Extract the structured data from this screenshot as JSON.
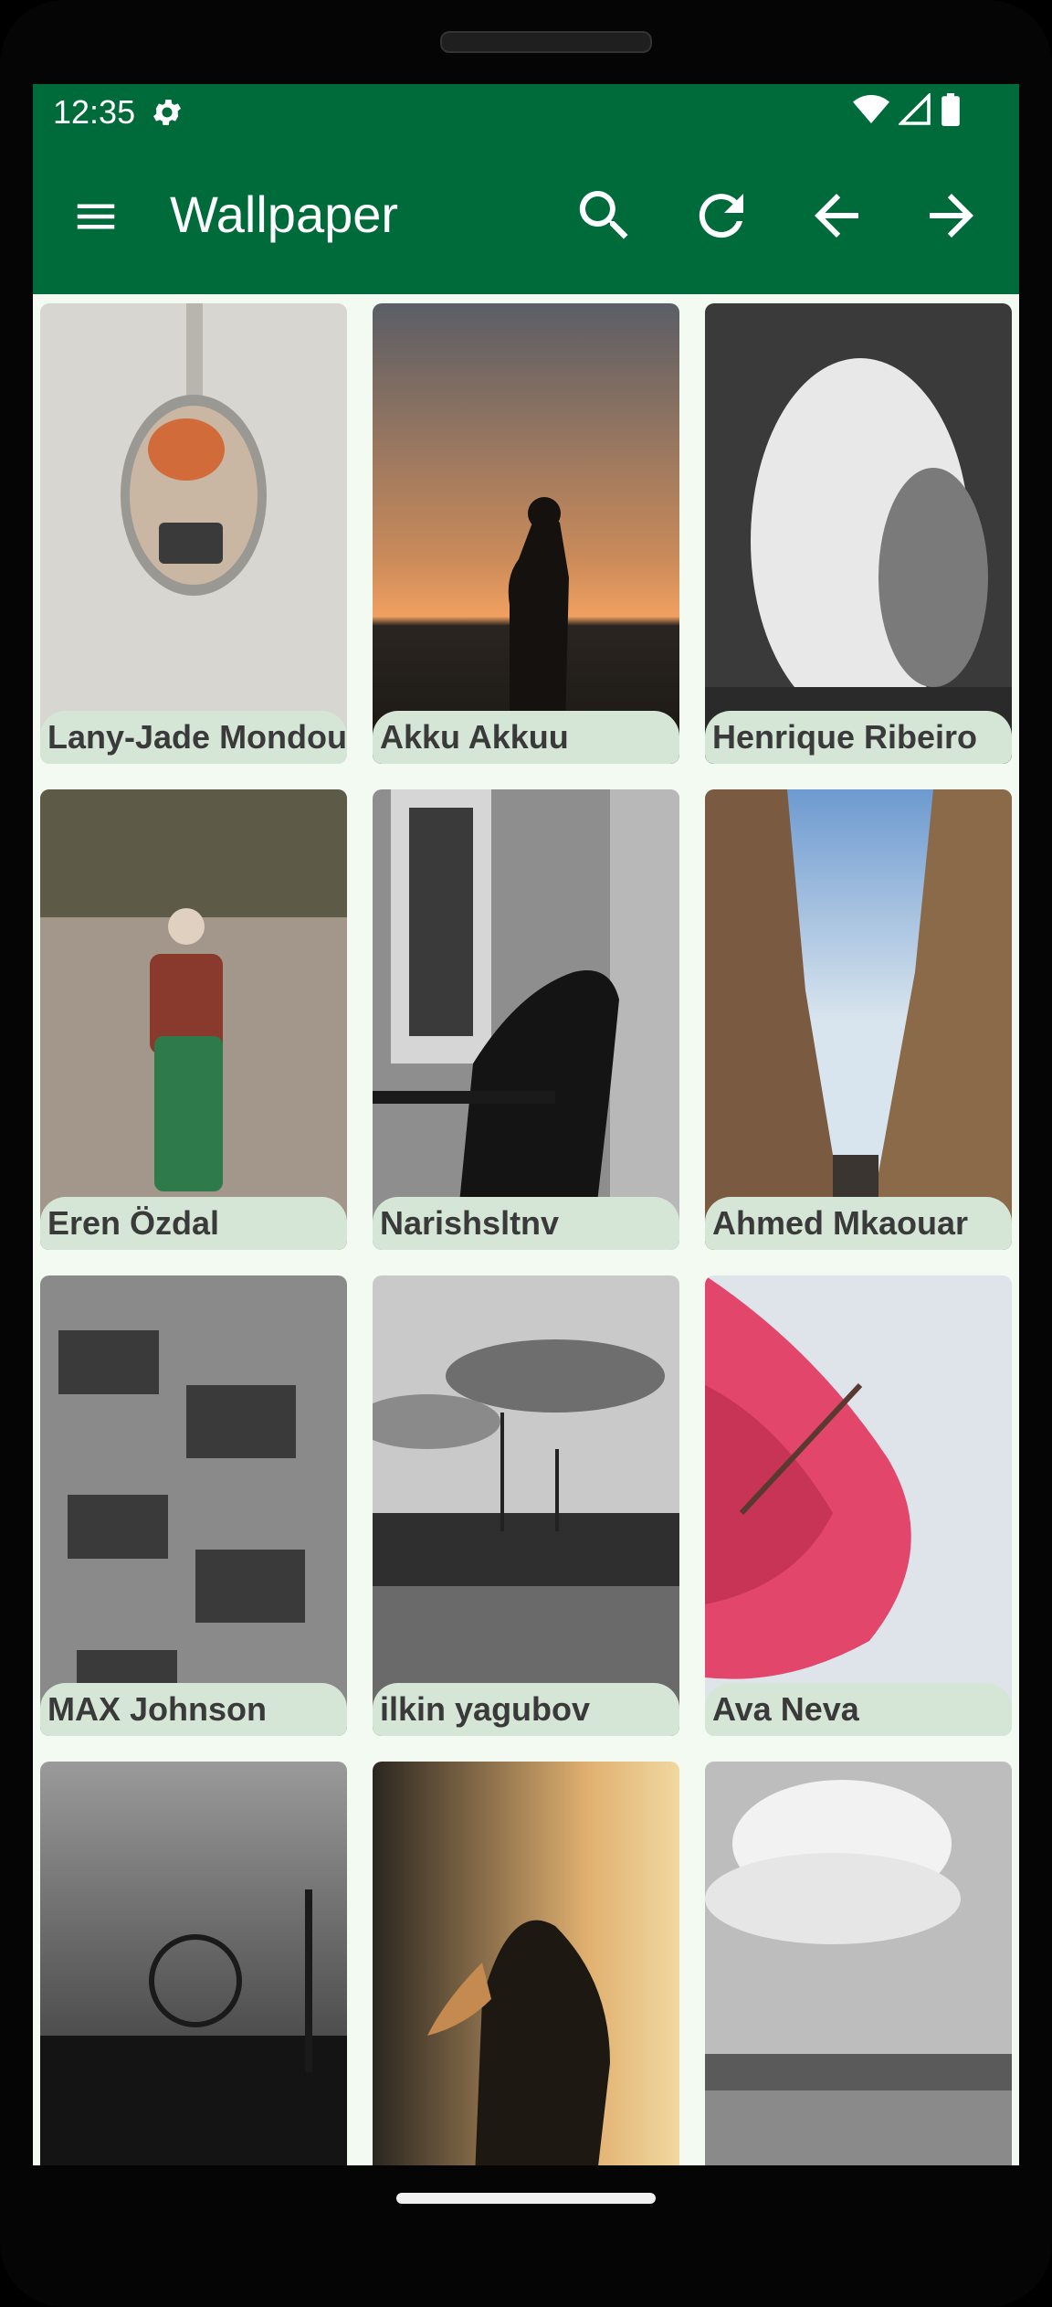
{
  "status": {
    "time": "12:35",
    "icons": [
      "settings-gear-icon",
      "wifi-icon",
      "cellular-signal-icon",
      "battery-icon"
    ]
  },
  "app_bar": {
    "title": "Wallpaper",
    "actions": [
      "search-icon",
      "refresh-icon",
      "arrow-back-icon",
      "arrow-forward-icon"
    ]
  },
  "colors": {
    "primary": "#006b3a",
    "background": "#f3faf1",
    "label_chip": "#d5e6d7"
  },
  "cards": [
    {
      "name": "Lany-Jade Mondou"
    },
    {
      "name": "Akku Akkuu"
    },
    {
      "name": "Henrique Ribeiro"
    },
    {
      "name": "Eren Özdal"
    },
    {
      "name": "Narishsltnv"
    },
    {
      "name": "Ahmed Mkaouar"
    },
    {
      "name": "MAX Johnson"
    },
    {
      "name": "ilkin yagubov"
    },
    {
      "name": "Ava Neva"
    },
    {
      "name": ""
    },
    {
      "name": ""
    },
    {
      "name": ""
    }
  ]
}
